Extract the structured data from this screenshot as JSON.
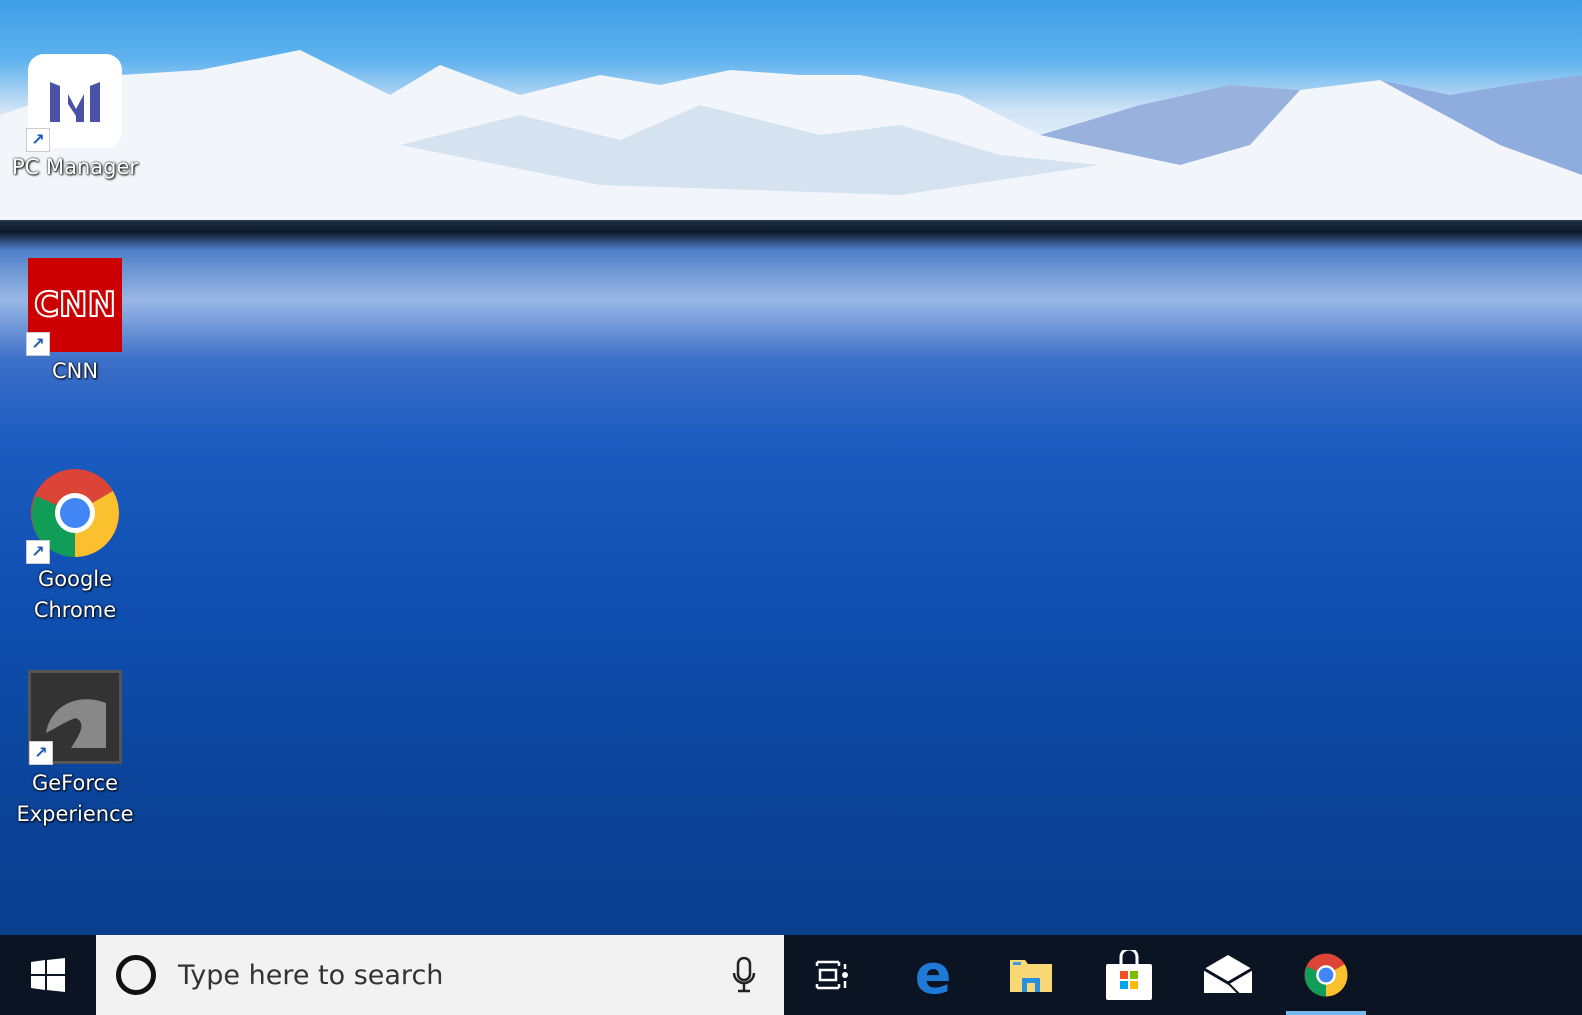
{
  "desktop_icons": [
    {
      "label": "PC Manager",
      "icon": "pc-manager-icon"
    },
    {
      "label": "CNN",
      "icon": "cnn-icon",
      "logo_text": "CNN"
    },
    {
      "label": "Google Chrome",
      "icon": "chrome-icon"
    },
    {
      "label": "GeForce Experience",
      "icon": "geforce-icon"
    }
  ],
  "taskbar": {
    "search_placeholder": "Type here to search",
    "apps": [
      "task-view",
      "edge",
      "file-explorer",
      "microsoft-store",
      "mail",
      "chrome"
    ],
    "active_app": "chrome"
  },
  "colors": {
    "taskbar": "#0b1422",
    "search_bg": "#f2f2f2",
    "active_indicator": "#76b9ed",
    "cnn_red": "#cc0000"
  }
}
